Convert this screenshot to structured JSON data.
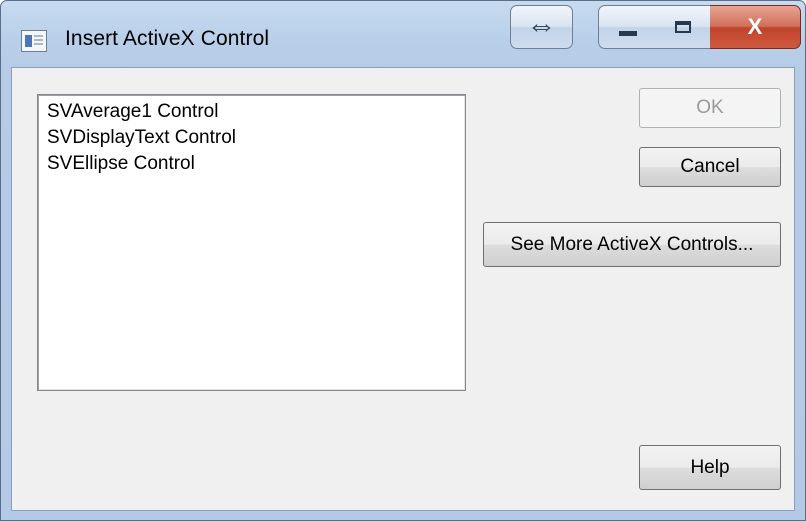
{
  "window": {
    "title": "Insert ActiveX Control",
    "title_icon": "app-window-icon",
    "controls": {
      "resize_icon": "⇔",
      "minimize_icon": "minimize-icon",
      "maximize_icon": "maximize-icon",
      "close_label": "X"
    }
  },
  "list": {
    "items": [
      "SVAverage1 Control",
      "SVDisplayText Control",
      "SVEllipse Control"
    ]
  },
  "buttons": {
    "ok": "OK",
    "cancel": "Cancel",
    "see_more": "See More ActiveX Controls...",
    "help": "Help"
  },
  "colors": {
    "frame": "#b9cfe9",
    "close": "#c0432b",
    "client": "#f0f0f0"
  }
}
